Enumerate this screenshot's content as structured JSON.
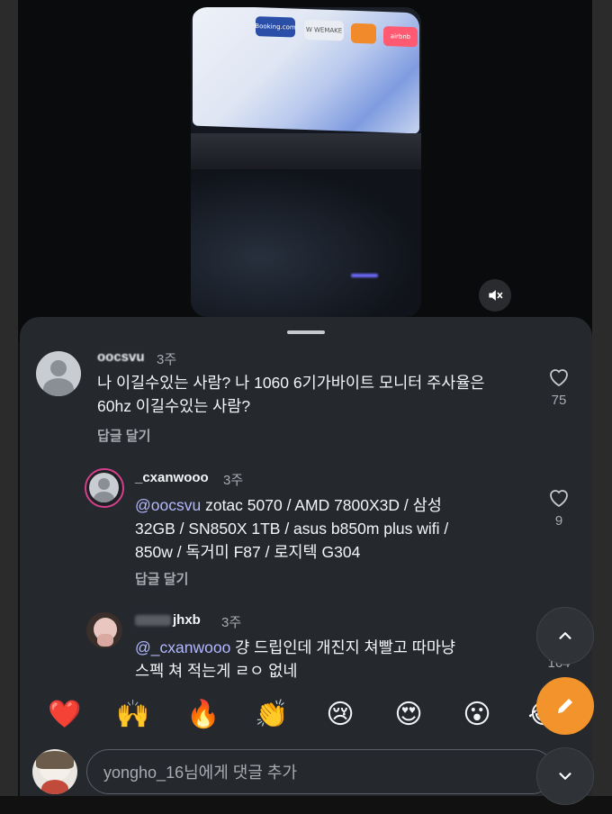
{
  "video": {
    "tiles": [
      "Booking.com",
      "W WEMAKE",
      "",
      "airbnb"
    ]
  },
  "comments": [
    {
      "username": "oocsvu",
      "time": "3주",
      "text": "나 이길수있는 사람? 나 1060 6기가바이트 모니터 주사율은 60hz 이길수있는 사람?",
      "text_line1": "나 이길수있는 사람? 나 1060 6기가바이트 모니터 주사율은",
      "text_line2": "60hz 이길수있는 사람?",
      "reply_label": "답글 달기",
      "likes": "75"
    },
    {
      "username": "_cxanwooo",
      "time": "3주",
      "mention": "@oocsvu",
      "text_line1": " zotac 5070 / AMD 7800X3D / 삼성",
      "text_line2": "32GB / SN850X 1TB / asus b850m plus wifi /",
      "text_line3": "850w / 독거미 F87 / 로지텍 G304",
      "reply_label": "답글 달기",
      "likes": "9"
    },
    {
      "username": "jhxb",
      "time": "3주",
      "mention": "@_cxanwooo",
      "text_line1": " 걍 드립인데 개진지 쳐빨고 따마냥",
      "text_line2": "스펙 쳐 적는게 ㄹㅇ 없네",
      "likes": "164"
    }
  ],
  "emojis": [
    "❤️",
    "🙌",
    "🔥",
    "👏",
    "😢",
    "😍",
    "😮",
    "😂"
  ],
  "input": {
    "placeholder": "yongho_16님에게 댓글 추가"
  },
  "colors": {
    "accent_orange": "#f2942b",
    "mention": "#b3b8ff",
    "sheet_bg": "#25292e"
  }
}
